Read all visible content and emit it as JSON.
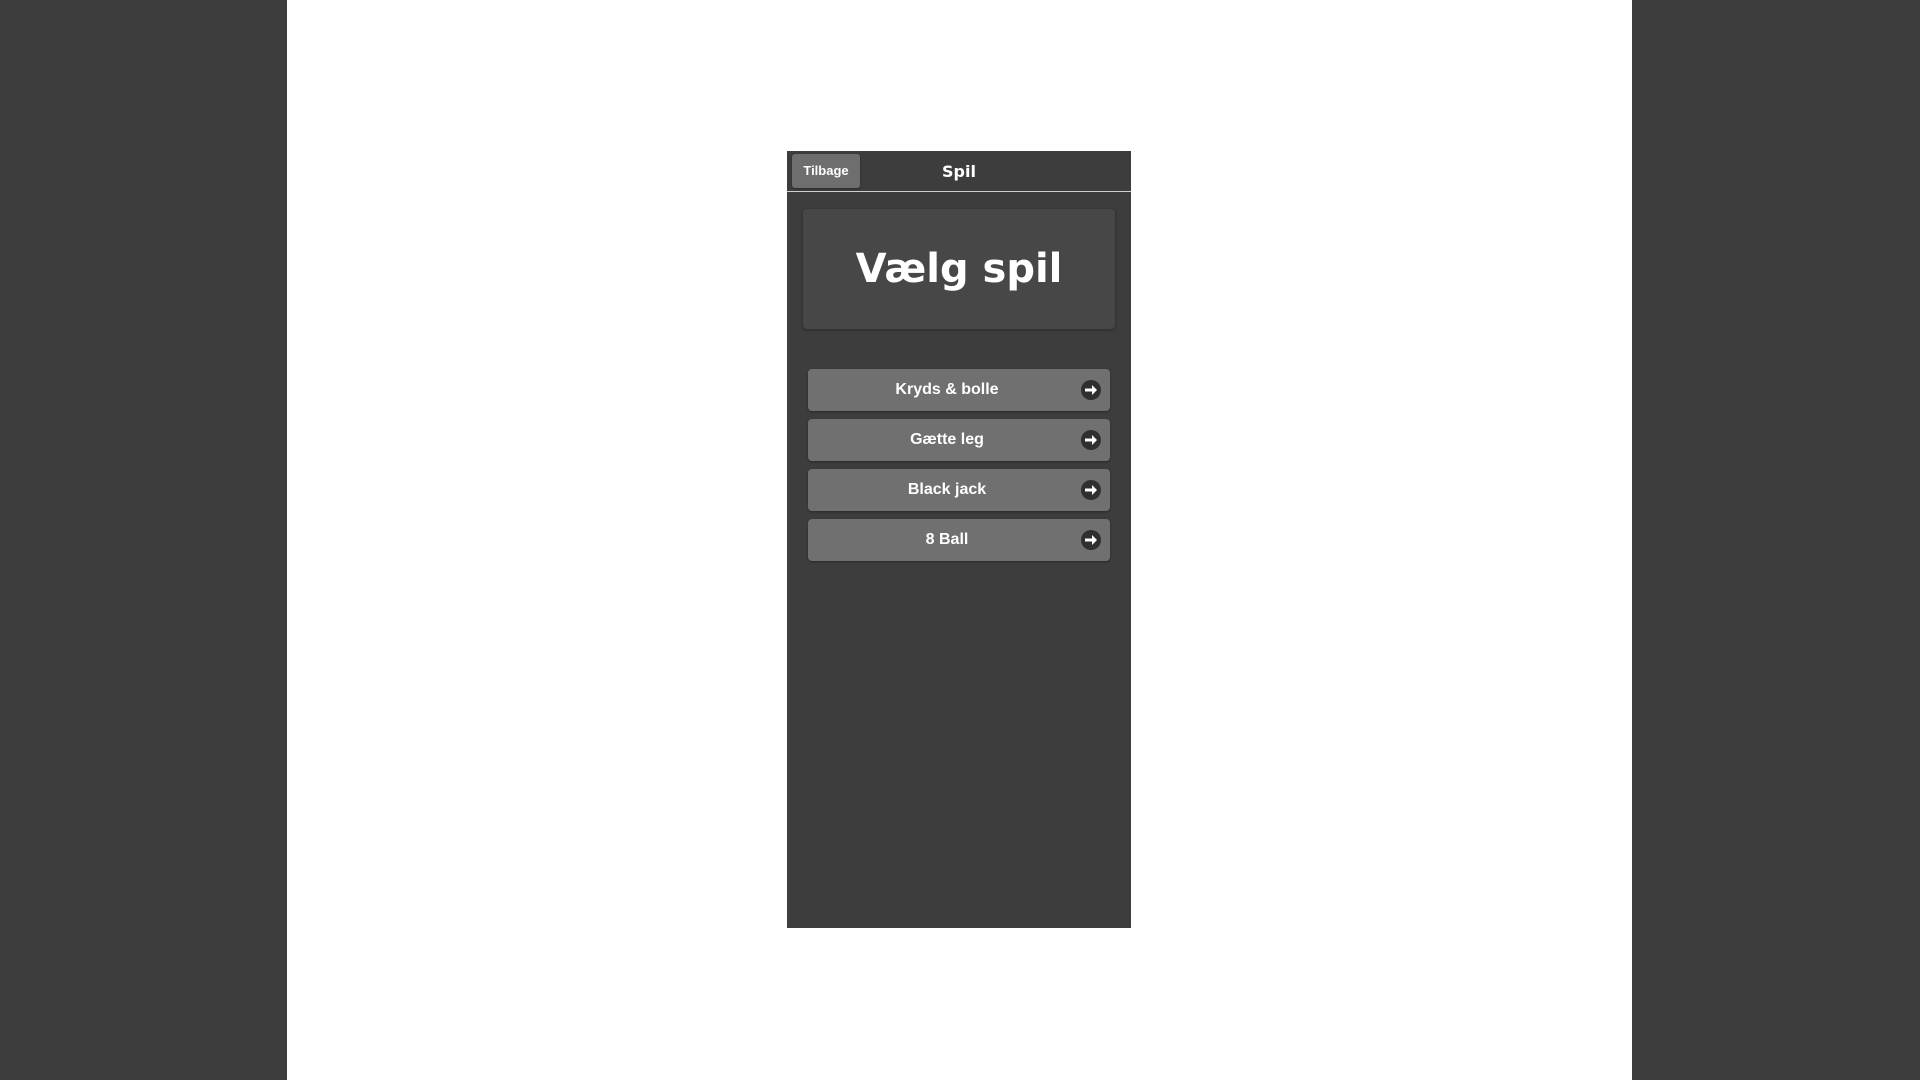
{
  "header": {
    "back_label": "Tilbage",
    "title": "Spil"
  },
  "main": {
    "heading": "Vælg spil"
  },
  "games": [
    {
      "label": "Kryds & bolle",
      "icon": "arrow-right-icon"
    },
    {
      "label": "Gætte leg",
      "icon": "arrow-right-icon"
    },
    {
      "label": "Black jack",
      "icon": "arrow-right-icon"
    },
    {
      "label": "8 Ball",
      "icon": "arrow-right-icon"
    }
  ],
  "colors": {
    "background": "#3d3d3d",
    "page": "#ffffff",
    "button": "#707070",
    "heading_box": "#474747",
    "text": "#ffffff"
  }
}
